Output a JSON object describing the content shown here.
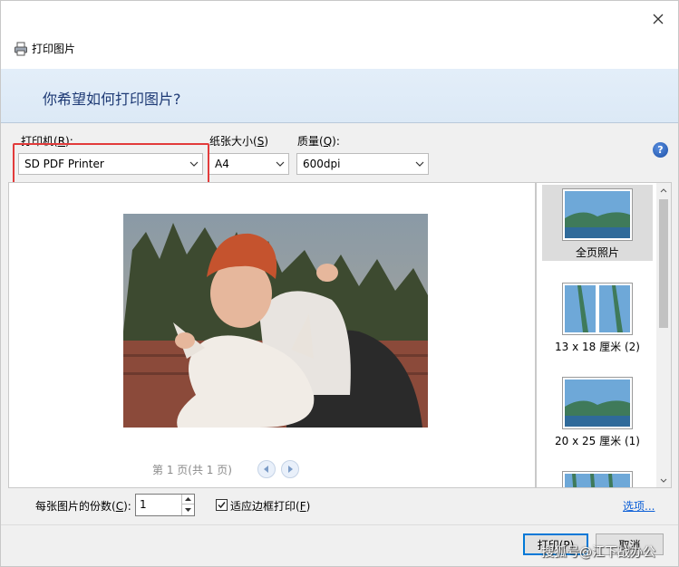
{
  "window": {
    "title": "打印图片",
    "question": "你希望如何打印图片?"
  },
  "printer": {
    "label": "打印机(R):",
    "label_main": "打印机(",
    "label_key": "R",
    "label_end": "):",
    "value": "SD PDF Printer"
  },
  "paper": {
    "label_main": "纸张大小(",
    "label_key": "S",
    "label_end": ")",
    "value": "A4"
  },
  "quality": {
    "label_main": "质量(",
    "label_key": "Q",
    "label_end": "):",
    "value": "600dpi"
  },
  "help": {
    "text": "?"
  },
  "pager": {
    "text": "第 1 页(共 1 页)"
  },
  "layouts": [
    {
      "caption": "全页照片",
      "selected": true
    },
    {
      "caption": "13 x 18 厘米 (2)",
      "selected": false
    },
    {
      "caption": "20 x 25 厘米 (1)",
      "selected": false
    }
  ],
  "copies": {
    "label_main": "每张图片的份数(",
    "label_key": "C",
    "label_end": "):",
    "value": "1"
  },
  "fit": {
    "label_main": "适应边框打印(",
    "label_key": "F",
    "label_end": ")",
    "checked": true
  },
  "options_link": "选项...",
  "buttons": {
    "print": "打印(P)",
    "cancel": "取消"
  },
  "watermark": "搜狐号@江下战办公",
  "colors": {
    "highlight": "#e23b3b",
    "banner_text": "#1e3a75",
    "link": "#0b5ed7"
  },
  "icons": {
    "title": "printer-icon",
    "close": "close-icon",
    "help": "help-icon"
  }
}
